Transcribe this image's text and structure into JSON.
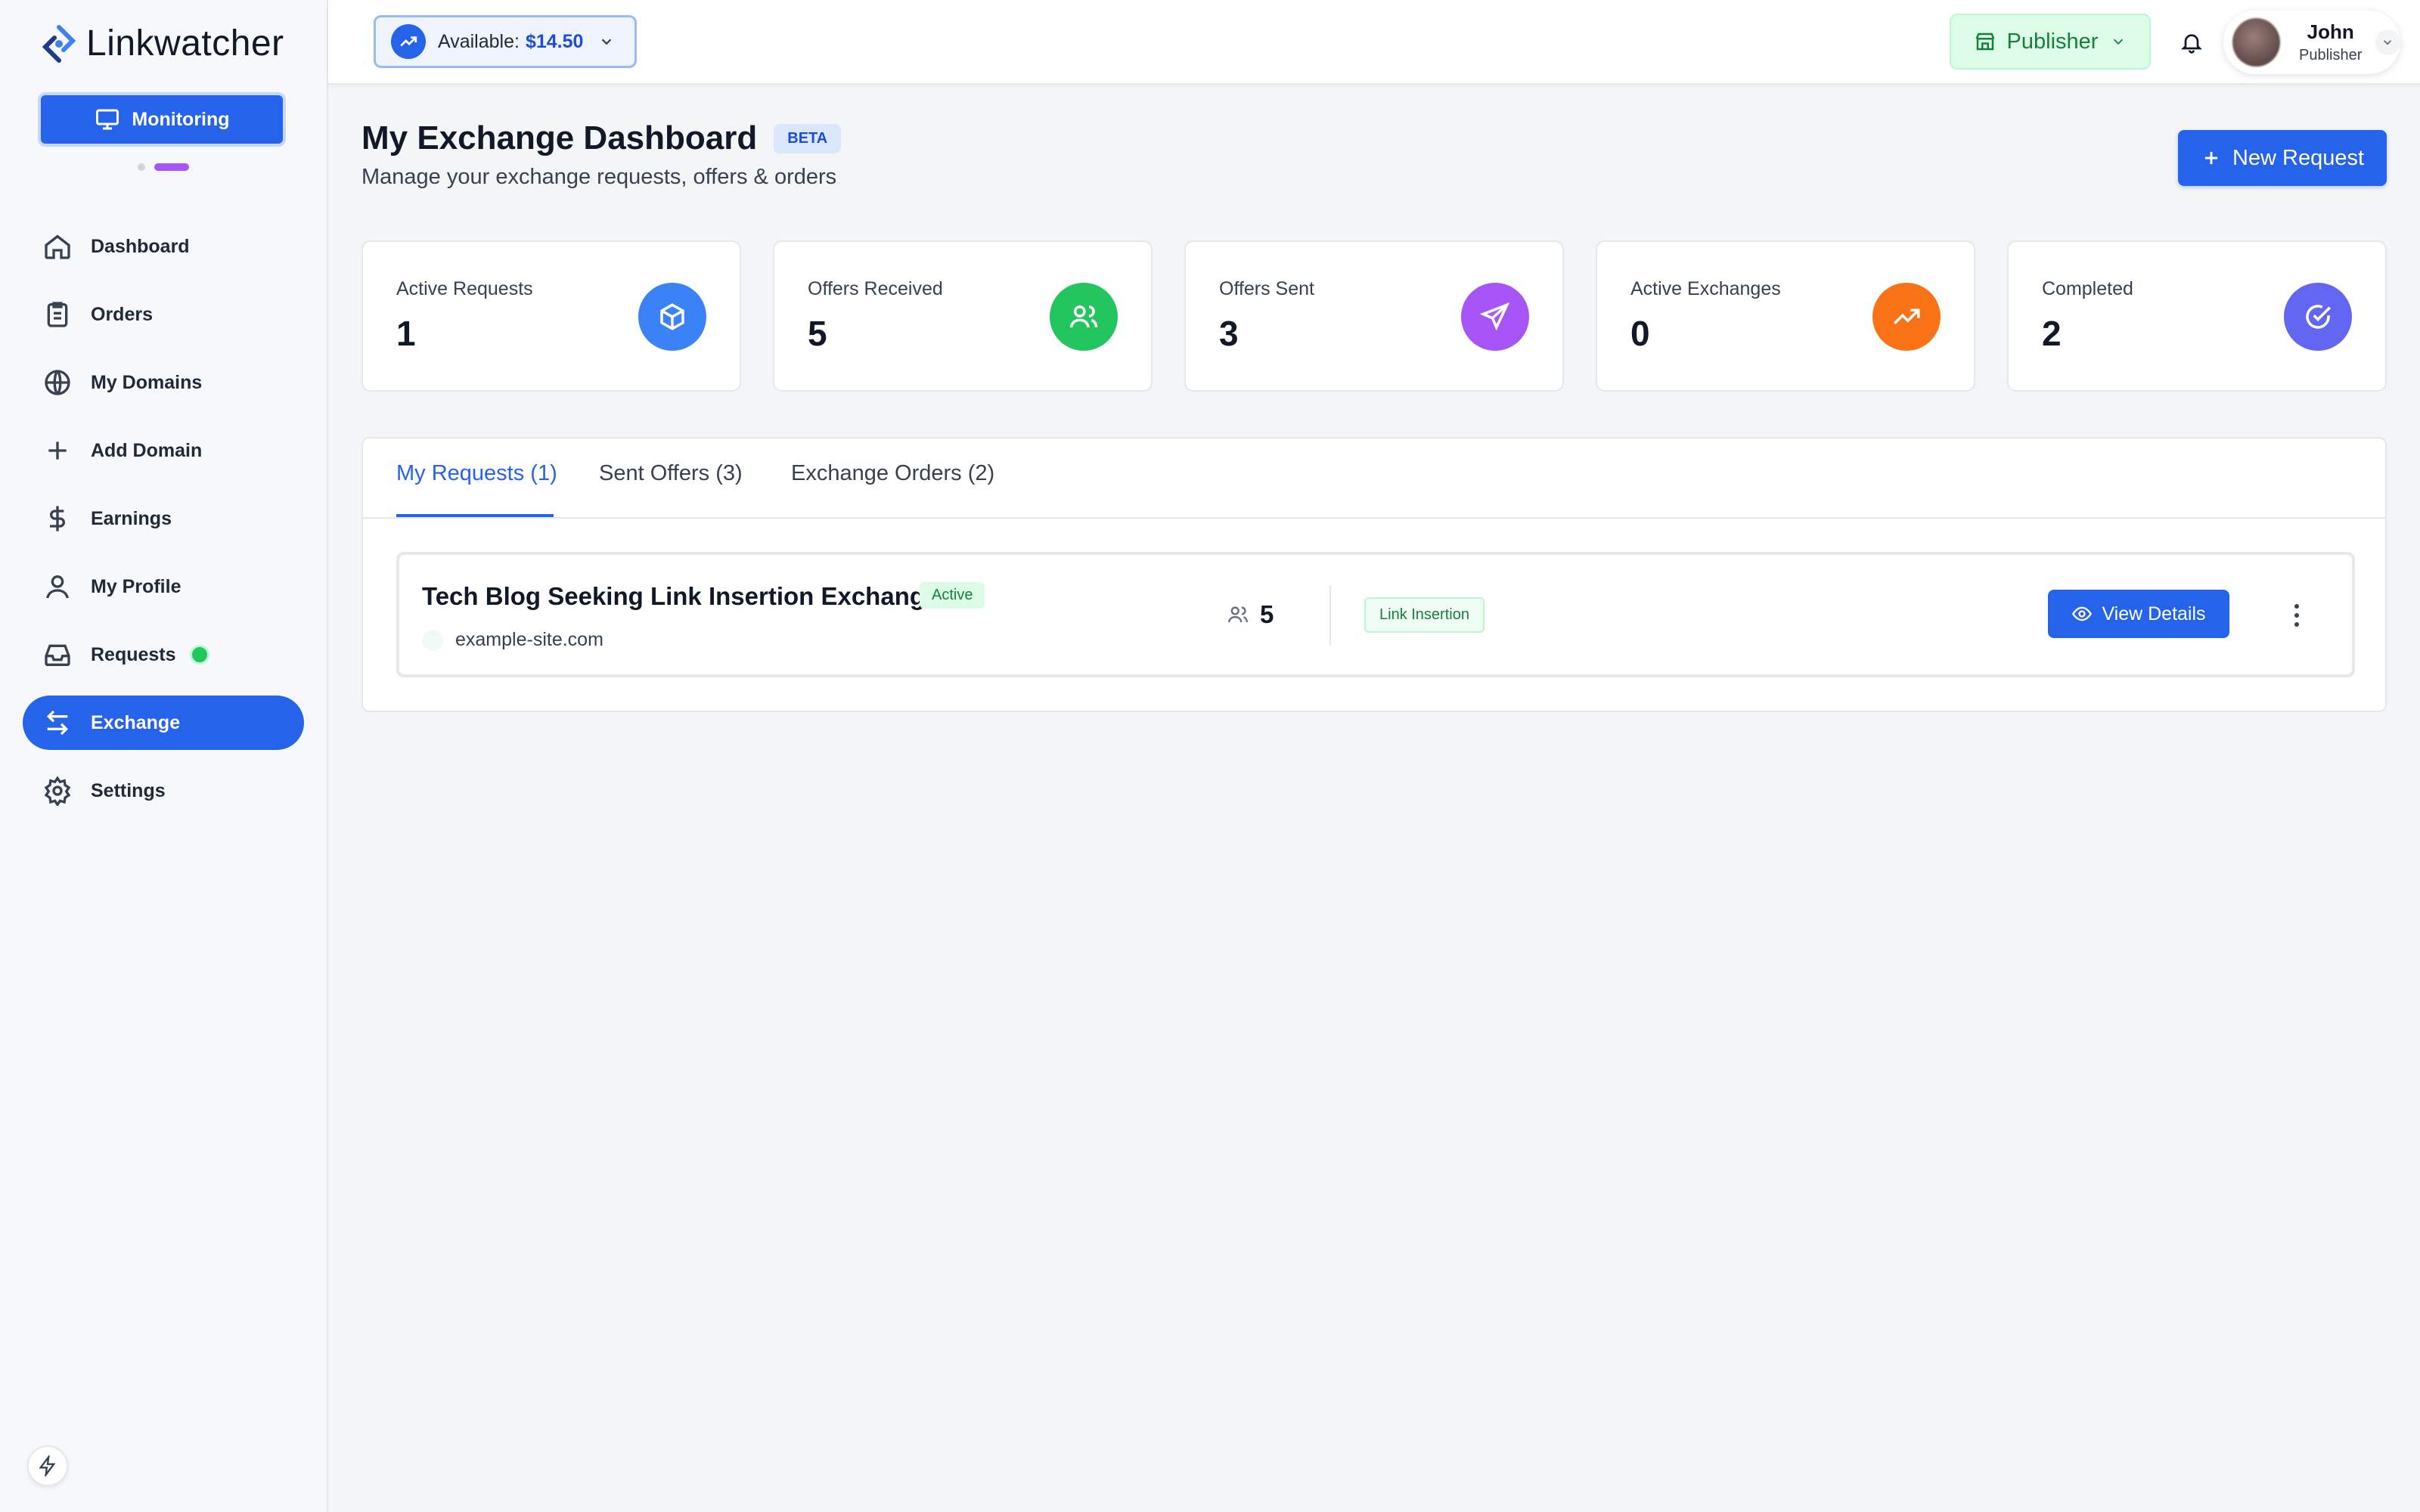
{
  "app": {
    "name": "Linkwatcher"
  },
  "sidebar": {
    "monitoring_label": "Monitoring",
    "items": [
      {
        "label": "Dashboard",
        "icon": "home-icon"
      },
      {
        "label": "Orders",
        "icon": "clipboard-icon"
      },
      {
        "label": "My Domains",
        "icon": "globe-icon"
      },
      {
        "label": "Add Domain",
        "icon": "plus-icon"
      },
      {
        "label": "Earnings",
        "icon": "dollar-icon"
      },
      {
        "label": "My Profile",
        "icon": "user-icon"
      },
      {
        "label": "Requests",
        "icon": "inbox-icon"
      },
      {
        "label": "Exchange",
        "icon": "exchange-icon",
        "active": true
      },
      {
        "label": "Settings",
        "icon": "gear-icon"
      }
    ]
  },
  "topbar": {
    "balance_label": "Available:",
    "balance_amount": "$14.50",
    "role_button": "Publisher",
    "user": {
      "name": "John",
      "role": "Publisher"
    }
  },
  "page": {
    "title": "My Exchange Dashboard",
    "badge": "BETA",
    "subtitle": "Manage your exchange requests, offers & orders",
    "new_request_label": "New Request"
  },
  "stats": [
    {
      "label": "Active Requests",
      "value": "1",
      "color": "#3b82f6",
      "icon": "box-icon"
    },
    {
      "label": "Offers Received",
      "value": "5",
      "color": "#22c55e",
      "icon": "users-icon"
    },
    {
      "label": "Offers Sent",
      "value": "3",
      "color": "#a855f7",
      "icon": "send-icon"
    },
    {
      "label": "Active Exchanges",
      "value": "0",
      "color": "#f97316",
      "icon": "trending-up-icon"
    },
    {
      "label": "Completed",
      "value": "2",
      "color": "#6366f1",
      "icon": "check-circle-icon"
    }
  ],
  "tabs": [
    {
      "label": "My Requests (1)",
      "active": true
    },
    {
      "label": "Sent Offers (3)"
    },
    {
      "label": "Exchange Orders (2)"
    }
  ],
  "requests": [
    {
      "title": "Tech Blog Seeking Link Insertion Exchange",
      "status": "Active",
      "domain": "example-site.com",
      "offers": "5",
      "type": "Link Insertion",
      "action_label": "View Details"
    }
  ]
}
